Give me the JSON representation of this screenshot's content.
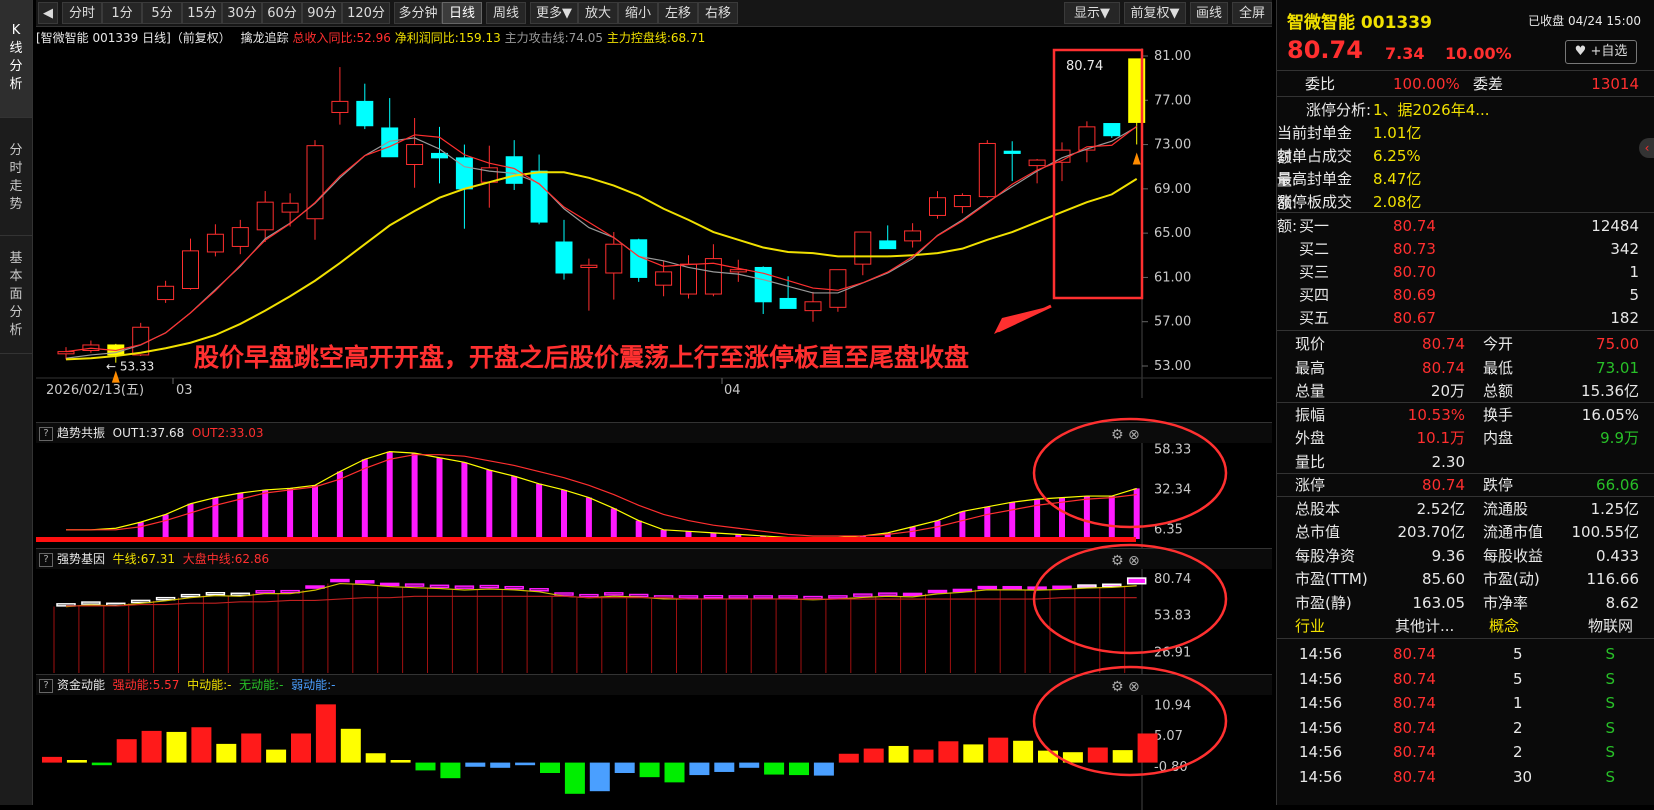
{
  "left_tabs": [
    "K线分析",
    "分时走势",
    "基本面分析"
  ],
  "toolbar": {
    "buttons": [
      "分时",
      "1分",
      "5分",
      "15分",
      "30分",
      "60分",
      "90分",
      "120分",
      "多分钟",
      "日线",
      "周线",
      "更多▼",
      "放大",
      "缩小",
      "左移",
      "右移"
    ],
    "right_buttons": [
      "显示▼",
      "前复权▼",
      "画线",
      "全屏"
    ],
    "active": "日线"
  },
  "infobar": {
    "title": "[智微智能 001339 日线]（前复权）",
    "tracker": "擒龙追踪",
    "income": "总收入同比:52.96",
    "profit": "净利润同比:159.13",
    "attack": "主力攻击线:74.05",
    "control": "主力控盘线:68.71"
  },
  "chart_data": [
    {
      "type": "candlestick",
      "title": "智微智能 001339 日线",
      "ylim": [
        53,
        81
      ],
      "y_ticks": [
        "81.00",
        "77.00",
        "73.00",
        "69.00",
        "65.00",
        "61.00",
        "57.00",
        "53.00"
      ],
      "x_labels": [
        "2026/02/13(五)",
        "03",
        "04"
      ],
      "series": [
        {
          "name": "candles",
          "values": [
            [
              54.1,
              54.7,
              53.6,
              54.3
            ],
            [
              54.4,
              55.3,
              54.2,
              54.9
            ],
            [
              54.9,
              55.0,
              53.3,
              54.0
            ],
            [
              54.0,
              56.9,
              53.9,
              56.5
            ],
            [
              59.0,
              60.7,
              58.7,
              60.2
            ],
            [
              60.0,
              64.5,
              59.9,
              63.4
            ],
            [
              63.3,
              65.8,
              62.9,
              64.9
            ],
            [
              63.8,
              66.2,
              63.1,
              65.5
            ],
            [
              65.3,
              68.8,
              64.2,
              67.8
            ],
            [
              66.9,
              68.6,
              65.6,
              67.7
            ],
            [
              66.3,
              73.4,
              64.4,
              72.9
            ],
            [
              75.9,
              80.0,
              74.8,
              76.9
            ],
            [
              76.9,
              78.5,
              74.4,
              74.7
            ],
            [
              74.5,
              77.2,
              72.6,
              71.9
            ],
            [
              71.2,
              75.4,
              69.1,
              73.0
            ],
            [
              72.2,
              74.6,
              69.5,
              71.8
            ],
            [
              71.8,
              73.0,
              65.4,
              69.0
            ],
            [
              69.6,
              72.9,
              67.3,
              70.9
            ],
            [
              71.9,
              73.4,
              68.9,
              69.5
            ],
            [
              70.6,
              72.1,
              65.8,
              66.0
            ],
            [
              64.2,
              66.2,
              60.8,
              61.4
            ],
            [
              61.9,
              62.7,
              58.0,
              62.1
            ],
            [
              61.4,
              65.1,
              59.0,
              64.0
            ],
            [
              64.4,
              64.5,
              60.6,
              61.0
            ],
            [
              60.3,
              62.5,
              59.3,
              61.5
            ],
            [
              59.5,
              63.0,
              59.1,
              62.2
            ],
            [
              59.5,
              64.0,
              59.3,
              62.7
            ],
            [
              61.5,
              62.6,
              60.6,
              61.7
            ],
            [
              61.9,
              62.0,
              57.7,
              58.8
            ],
            [
              59.1,
              61.1,
              58.4,
              58.2
            ],
            [
              58.0,
              59.7,
              57.0,
              58.8
            ],
            [
              58.3,
              60.2,
              57.9,
              61.7
            ],
            [
              62.2,
              64.7,
              61.2,
              65.1
            ],
            [
              64.3,
              65.7,
              63.6,
              63.6
            ],
            [
              64.3,
              65.9,
              63.7,
              65.2
            ],
            [
              66.6,
              68.8,
              66.3,
              68.2
            ],
            [
              67.4,
              68.6,
              66.8,
              68.4
            ],
            [
              68.3,
              73.4,
              68.2,
              73.1
            ],
            [
              72.4,
              73.3,
              69.7,
              72.2
            ],
            [
              71.1,
              71.7,
              69.5,
              71.6
            ],
            [
              71.4,
              73.2,
              69.7,
              72.5
            ],
            [
              72.5,
              75.1,
              71.4,
              74.6
            ],
            [
              74.9,
              74.6,
              73.6,
              73.8
            ],
            [
              75.0,
              80.74,
              73.01,
              80.74
            ]
          ]
        },
        {
          "name": "MA5",
          "values": [
            53.7,
            54.0,
            54.2,
            54.9,
            56.0,
            57.8,
            59.9,
            62.0,
            64.5,
            65.9,
            67.7,
            70.0,
            72.0,
            73.3,
            73.6,
            72.6,
            71.0,
            70.6,
            70.4,
            69.5,
            67.2,
            65.5,
            64.6,
            62.9,
            62.5,
            61.9,
            61.5,
            61.3,
            60.8,
            60.2,
            59.6,
            59.6,
            60.5,
            61.4,
            62.7,
            64.8,
            66.2,
            67.8,
            69.2,
            70.6,
            71.8,
            72.6,
            73.3,
            74.6
          ]
        },
        {
          "name": "MA10",
          "values": [
            53.6,
            53.7,
            53.9,
            54.2,
            54.6,
            55.1,
            55.8,
            56.8,
            58.0,
            59.3,
            60.7,
            62.3,
            64.0,
            65.7,
            67.0,
            68.2,
            69.0,
            69.6,
            70.2,
            70.5,
            70.5,
            70.0,
            69.3,
            68.4,
            67.2,
            66.2,
            65.1,
            64.4,
            63.7,
            63.3,
            63.2,
            62.9,
            62.9,
            62.9,
            63.0,
            63.2,
            63.6,
            64.4,
            65.1,
            66.0,
            66.9,
            67.8,
            68.5,
            69.9
          ]
        }
      ]
    },
    {
      "type": "bar",
      "title": "趋势共振",
      "ylim": [
        0,
        60
      ],
      "y_ticks": [
        "58.33",
        "32.34",
        "6.35"
      ],
      "series": [
        {
          "name": "OUT1:37.68",
          "values": [
            6,
            6,
            7,
            11,
            16,
            23,
            27,
            30,
            32,
            33,
            35,
            44,
            52,
            57,
            56,
            53,
            50,
            45,
            41,
            36,
            32,
            27,
            20,
            12,
            6,
            5,
            4,
            3,
            2,
            1,
            1,
            1,
            2,
            4,
            8,
            12,
            18,
            21,
            24,
            26,
            27,
            28,
            28,
            33
          ]
        },
        {
          "name": "OUT2:33.03",
          "values": [
            6,
            6,
            6,
            8,
            12,
            17,
            22,
            26,
            30,
            32,
            34,
            39,
            46,
            52,
            55,
            55,
            54,
            51,
            48,
            44,
            40,
            35,
            29,
            22,
            16,
            12,
            9,
            7,
            5,
            3,
            2,
            2,
            2,
            3,
            5,
            8,
            12,
            16,
            19,
            22,
            24,
            26,
            27,
            29
          ]
        }
      ]
    },
    {
      "type": "bar",
      "title": "强势基因",
      "ylim": [
        15,
        85
      ],
      "y_ticks": [
        "80.74",
        "53.83",
        "26.91"
      ],
      "series": [
        {
          "name": "牛线:67.31",
          "values": [
            [
              62.0,
              62.5
            ],
            [
              63.2,
              63.8
            ],
            [
              62.5,
              62.9
            ],
            [
              64.4,
              65.0
            ],
            [
              66.2,
              67.0
            ],
            [
              68.5,
              69.2
            ],
            [
              70.0,
              70.6
            ],
            [
              69.5,
              70.2
            ],
            [
              71.5,
              72.0
            ],
            [
              71.4,
              72.1
            ],
            [
              74.0,
              75.5
            ],
            [
              78.8,
              80.2
            ],
            [
              78.1,
              79.3
            ],
            [
              76.6,
              77.4
            ],
            [
              75.8,
              76.9
            ],
            [
              75.2,
              76.0
            ],
            [
              74.1,
              75.4
            ],
            [
              74.8,
              75.8
            ],
            [
              74.2,
              75.0
            ],
            [
              72.8,
              73.5
            ],
            [
              69.6,
              70.4
            ],
            [
              68.4,
              69.2
            ],
            [
              69.6,
              70.5
            ],
            [
              68.9,
              69.3
            ],
            [
              67.6,
              68.3
            ],
            [
              67.6,
              68.3
            ],
            [
              67.6,
              68.4
            ],
            [
              67.6,
              68.3
            ],
            [
              67.6,
              68.3
            ],
            [
              67.6,
              68.3
            ],
            [
              67.0,
              67.8
            ],
            [
              67.6,
              68.3
            ],
            [
              68.7,
              69.6
            ],
            [
              69.5,
              70.3
            ],
            [
              69.1,
              70.1
            ],
            [
              71.3,
              72.2
            ],
            [
              72.4,
              73.0
            ],
            [
              74.3,
              75.1
            ],
            [
              74.2,
              75.0
            ],
            [
              74.0,
              74.7
            ],
            [
              74.5,
              75.3
            ],
            [
              75.5,
              76.2
            ],
            [
              76.0,
              76.8
            ],
            [
              77.2,
              81.3
            ]
          ]
        },
        {
          "name": "大盘中线:62.86",
          "values": [
            61,
            61,
            61,
            62,
            62,
            63,
            63,
            64,
            64,
            65,
            65,
            66,
            67,
            67,
            68,
            68,
            68,
            68,
            68,
            68,
            68,
            67,
            67,
            67,
            67,
            66,
            66,
            66,
            66,
            66,
            66,
            66,
            66,
            66,
            66,
            66,
            66,
            66,
            66,
            66,
            67,
            67,
            67,
            67
          ]
        }
      ]
    },
    {
      "type": "bar",
      "title": "资金动能",
      "ylim": [
        -7,
        13
      ],
      "y_ticks": [
        "10.94",
        "5.07",
        "-0.80"
      ],
      "labels": {
        "strong": "强动能:5.57",
        "mid": "中动能:-",
        "none": "无动能:-",
        "weak": "弱动能:-"
      },
      "values": [
        1.1,
        0.5,
        -0.5,
        4.5,
        6.1,
        5.9,
        6.8,
        3.6,
        5.6,
        2.5,
        5.6,
        11.2,
        6.5,
        1.8,
        0.5,
        -1.5,
        -3.0,
        -0.8,
        -1.0,
        -0.5,
        -2.0,
        -6.0,
        -5.5,
        -2.0,
        -2.8,
        -3.8,
        -2.4,
        -1.8,
        -1.0,
        -2.3,
        -2.4,
        -2.5,
        1.7,
        2.7,
        3.2,
        2.5,
        4.1,
        3.5,
        4.8,
        4.2,
        2.3,
        2.0,
        2.9,
        2.4,
        5.6
      ],
      "colors": [
        "red",
        "yellow",
        "green",
        "red",
        "red",
        "yellow",
        "red",
        "yellow",
        "red",
        "yellow",
        "red",
        "red",
        "yellow",
        "yellow",
        "yellow",
        "green",
        "green",
        "blue",
        "blue",
        "blue",
        "green",
        "green",
        "blue",
        "blue",
        "green",
        "green",
        "blue",
        "blue",
        "blue",
        "green",
        "green",
        "blue",
        "red",
        "red",
        "yellow",
        "red",
        "red",
        "yellow",
        "red",
        "yellow",
        "yellow",
        "yellow",
        "red",
        "yellow",
        "red"
      ]
    }
  ],
  "annotation": {
    "text": "股价早盘跳空高开开盘，开盘之后股价震荡上行至涨停板直至尾盘收盘",
    "low_label": "53.33",
    "high_label": "80.74"
  },
  "quote": {
    "name": "智微智能",
    "code": "001339",
    "status": "已收盘",
    "time": "04/24 15:00",
    "price": "80.74",
    "change": "7.34",
    "pct": "10.00%",
    "add_btn": "+自选",
    "webi_label": "委比",
    "webi": "100.00%",
    "weicha_label": "委差",
    "weicha": "13014",
    "limit_analysis": [
      [
        "涨停分析:",
        "1、据2026年4..."
      ],
      [
        "当前封单金额:",
        "1.01亿"
      ],
      [
        "封单占成交量:",
        "6.25%"
      ],
      [
        "最高封单金额:",
        "8.47亿"
      ],
      [
        "涨停板成交额:",
        "2.08亿"
      ]
    ],
    "bids": [
      [
        "买一",
        "80.74",
        "12484"
      ],
      [
        "买二",
        "80.73",
        "342"
      ],
      [
        "买三",
        "80.70",
        "1"
      ],
      [
        "买四",
        "80.69",
        "5"
      ],
      [
        "买五",
        "80.67",
        "182"
      ]
    ],
    "stats": [
      [
        "现价",
        "80.74",
        "red",
        "今开",
        "75.00",
        "red"
      ],
      [
        "最高",
        "80.74",
        "red",
        "最低",
        "73.01",
        "green"
      ],
      [
        "总量",
        "20万",
        "white",
        "总额",
        "15.36亿",
        "white"
      ],
      [
        "振幅",
        "10.53%",
        "red",
        "换手",
        "16.05%",
        "white"
      ],
      [
        "外盘",
        "10.1万",
        "red",
        "内盘",
        "9.9万",
        "green"
      ],
      [
        "量比",
        "2.30",
        "white",
        "",
        "",
        ""
      ],
      [
        "涨停",
        "80.74",
        "red",
        "跌停",
        "66.06",
        "green"
      ],
      [
        "总股本",
        "2.52亿",
        "white",
        "流通股",
        "1.25亿",
        "white"
      ],
      [
        "总市值",
        "203.70亿",
        "white",
        "流通市值",
        "100.55亿",
        "white"
      ],
      [
        "每股净资",
        "9.36",
        "white",
        "每股收益",
        "0.433",
        "white"
      ],
      [
        "市盈(TTM)",
        "85.60",
        "white",
        "市盈(动)",
        "116.66",
        "white"
      ],
      [
        "市盈(静)",
        "163.05",
        "white",
        "市净率",
        "8.62",
        "white"
      ]
    ],
    "industry": [
      "行业",
      "其他计...",
      "概念",
      "物联网"
    ],
    "ticks": [
      [
        "14:56",
        "80.74",
        "5",
        "S"
      ],
      [
        "14:56",
        "80.74",
        "5",
        "S"
      ],
      [
        "14:56",
        "80.74",
        "1",
        "S"
      ],
      [
        "14:56",
        "80.74",
        "2",
        "S"
      ],
      [
        "14:56",
        "80.74",
        "2",
        "S"
      ],
      [
        "14:56",
        "80.74",
        "30",
        "S"
      ]
    ]
  },
  "colors": {
    "up": "#ff2f2f",
    "down": "#00ffff",
    "ma5": "#999999",
    "ma10": "#f0e000",
    "magenta": "#ff1aff",
    "yellow": "#ffff00",
    "green": "#00e000",
    "blue": "#4a9fff",
    "box": "#ff3030"
  }
}
